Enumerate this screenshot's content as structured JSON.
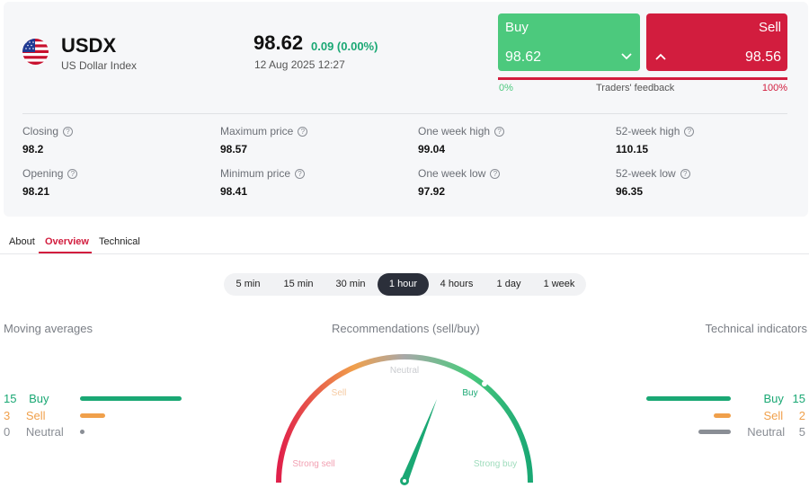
{
  "instrument": {
    "symbol": "USDX",
    "name": "US Dollar Index",
    "flag_icon": "us-flag-icon",
    "price": "98.62",
    "change": "0.09 (0.00%)",
    "datetime": "12 Aug 2025 12:27"
  },
  "trade": {
    "buy_label": "Buy",
    "buy_price": "98.62",
    "sell_label": "Sell",
    "sell_price": "98.56",
    "feedback_left": "0%",
    "feedback_label": "Traders' feedback",
    "feedback_right": "100%",
    "buy_color": "#4cc97d",
    "sell_color": "#d21d3e"
  },
  "stats": [
    {
      "label": "Closing",
      "value": "98.2"
    },
    {
      "label": "Maximum price",
      "value": "98.57"
    },
    {
      "label": "One week high",
      "value": "99.04"
    },
    {
      "label": "52-week high",
      "value": "110.15"
    },
    {
      "label": "Opening",
      "value": "98.21"
    },
    {
      "label": "Minimum price",
      "value": "98.41"
    },
    {
      "label": "One week low",
      "value": "97.92"
    },
    {
      "label": "52-week low",
      "value": "96.35"
    }
  ],
  "tabs": [
    {
      "label": "About",
      "active": false
    },
    {
      "label": "Overview",
      "active": true
    },
    {
      "label": "Technical",
      "active": false
    }
  ],
  "timeframes": [
    {
      "label": "5 min",
      "active": false
    },
    {
      "label": "15 min",
      "active": false
    },
    {
      "label": "30 min",
      "active": false
    },
    {
      "label": "1 hour",
      "active": true
    },
    {
      "label": "4 hours",
      "active": false
    },
    {
      "label": "1 day",
      "active": false
    },
    {
      "label": "1 week",
      "active": false
    }
  ],
  "moving_averages": {
    "title": "Moving averages",
    "rows": [
      {
        "count": "15",
        "label": "Buy",
        "color": "#1aa874"
      },
      {
        "count": "3",
        "label": "Sell",
        "color": "#f0a04b"
      },
      {
        "count": "0",
        "label": "Neutral",
        "color": "#8a8e95"
      }
    ]
  },
  "recommendations": {
    "title": "Recommendations (sell/buy)",
    "zones": [
      "Strong sell",
      "Sell",
      "Neutral",
      "Buy",
      "Strong buy"
    ],
    "level": 0.62
  },
  "technical_indicators": {
    "title": "Technical indicators",
    "rows": [
      {
        "count": "15",
        "label": "Buy",
        "color": "#1aa874"
      },
      {
        "count": "2",
        "label": "Sell",
        "color": "#f0a04b"
      },
      {
        "count": "5",
        "label": "Neutral",
        "color": "#8a8e95"
      }
    ]
  }
}
